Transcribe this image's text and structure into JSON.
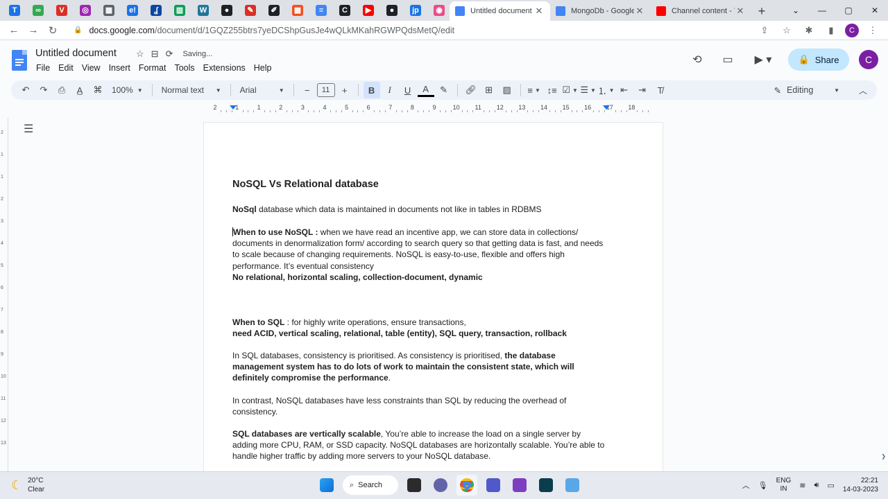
{
  "browser": {
    "pinned_tabs": [
      {
        "icon": "typora-icon",
        "glyph": "T",
        "color": "#1a73e8"
      },
      {
        "icon": "game-icon",
        "glyph": "∞",
        "color": "#34a853"
      },
      {
        "icon": "vivaldi-icon",
        "glyph": "V",
        "color": "#d93025"
      },
      {
        "icon": "swirl-icon",
        "glyph": "◎",
        "color": "#9c27b0"
      },
      {
        "icon": "grid-app-icon",
        "glyph": "▦",
        "color": "#5f6368"
      },
      {
        "icon": "e-icon",
        "glyph": "e!",
        "color": "#1a73e8"
      },
      {
        "icon": "codechef-icon",
        "glyph": "ʆ",
        "color": "#0d47a1"
      },
      {
        "icon": "sheet-icon",
        "glyph": "▥",
        "color": "#0f9d58"
      },
      {
        "icon": "wordpress-icon",
        "glyph": "W",
        "color": "#21759b"
      },
      {
        "icon": "github-icon",
        "glyph": "●",
        "color": "#202124"
      },
      {
        "icon": "red-app-icon",
        "glyph": "✎",
        "color": "#d93025"
      },
      {
        "icon": "pen-icon",
        "glyph": "✐",
        "color": "#202124"
      },
      {
        "icon": "microsoft-icon",
        "glyph": "▦",
        "color": "#f25022"
      },
      {
        "icon": "docs-icon",
        "glyph": "≡",
        "color": "#4285f4"
      },
      {
        "icon": "terminal-icon",
        "glyph": "C",
        "color": "#202124"
      },
      {
        "icon": "youtube-icon",
        "glyph": "▶",
        "color": "#ff0000"
      },
      {
        "icon": "github-icon",
        "glyph": "●",
        "color": "#202124"
      },
      {
        "icon": "jot-icon",
        "glyph": "jp",
        "color": "#1a73e8"
      },
      {
        "icon": "dribbble-icon",
        "glyph": "◉",
        "color": "#ea4c89"
      }
    ],
    "tabs": [
      {
        "title": "Untitled document",
        "active": true,
        "fav_color": "#4285f4"
      },
      {
        "title": "MongoDb - Google",
        "active": false,
        "fav_color": "#4285f4"
      },
      {
        "title": "Channel content - Yo",
        "active": false,
        "fav_color": "#ff0000"
      }
    ],
    "url_domain": "docs.google.com",
    "url_path": "/document/d/1GQZ255btrs7yeDCShpGusJe4wQLkMKahRGWPQdsMetQ/edit",
    "profile_initial": "C"
  },
  "docs": {
    "title": "Untitled document",
    "saving_status": "Saving...",
    "menu": [
      "File",
      "Edit",
      "View",
      "Insert",
      "Format",
      "Tools",
      "Extensions",
      "Help"
    ],
    "share_label": "Share",
    "avatar_initial": "C",
    "toolbar": {
      "zoom": "100%",
      "style": "Normal text",
      "font": "Arial",
      "font_size": "11",
      "mode": "Editing"
    },
    "ruler_numbers": [
      "2",
      "1",
      "1",
      "2",
      "3",
      "4",
      "5",
      "6",
      "7",
      "8",
      "9",
      "10",
      "11",
      "12",
      "13",
      "14",
      "15",
      "16",
      "17",
      "18"
    ],
    "vruler_numbers": [
      "2",
      "1",
      "1",
      "2",
      "3",
      "4",
      "5",
      "6",
      "7",
      "8",
      "9",
      "10",
      "11",
      "12",
      "13"
    ]
  },
  "document": {
    "heading": "NoSQL Vs Relational database",
    "p1": {
      "bold": "NoSql",
      "text": " database which data is maintained in documents not like in tables in RDBMS"
    },
    "p2": {
      "bold": "When to use NoSQL : ",
      "text": " when we have read an incentive app, we can store data in collections/ documents in denormalization form/ according to search query so that getting data is fast, and needs to scale because of changing requirements. NoSQL is easy-to-use, flexible and offers high performance. It’s eventual consistency"
    },
    "p3": "No relational, horizontal scaling, collection-document, dynamic",
    "p4": {
      "bold": "When to SQL",
      "text": " : for highly write operations, ensure transactions,"
    },
    "p5": "need ACID, vertical scaling, relational, table (entity), SQL query, transaction, rollback",
    "p6": {
      "text": "In SQL databases, consistency is prioritised. As consistency is prioritised, ",
      "bold": "the database management system has to do lots of work to maintain the consistent state, which will definitely compromise the performance",
      "tail": "."
    },
    "p7": "In contrast, NoSQL databases have less constraints than SQL by reducing the overhead of consistency.",
    "p8": {
      "bold": "SQL databases are vertically scalable",
      "text": ", You’re able to increase the load on a single server by adding more CPU, RAM, or SSD capacity. NoSQL databases are horizontally scalable. You’re able to handle higher traffic by adding more servers to your NoSQL database."
    }
  },
  "taskbar": {
    "temperature": "20°C",
    "weather": "Clear",
    "search_label": "Search",
    "lang_top": "ENG",
    "lang_bottom": "IN",
    "time": "22:21",
    "date": "14-03-2023"
  }
}
